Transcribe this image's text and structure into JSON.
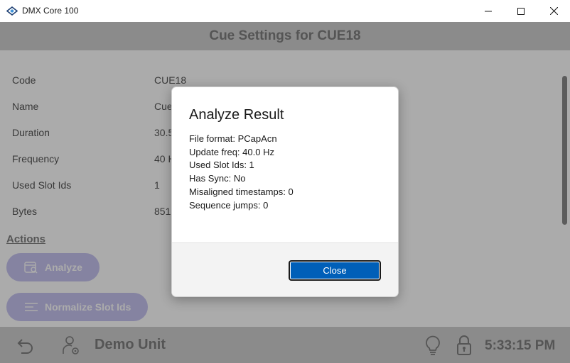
{
  "window": {
    "title": "DMX Core 100"
  },
  "header": {
    "title": "Cue Settings for CUE18"
  },
  "properties": [
    {
      "label": "Code",
      "value": "CUE18"
    },
    {
      "label": "Name",
      "value": "Cue"
    },
    {
      "label": "Duration",
      "value": "30.5"
    },
    {
      "label": "Frequency",
      "value": "40 H"
    },
    {
      "label": "Used Slot Ids",
      "value": "1"
    },
    {
      "label": "Bytes",
      "value": "851"
    }
  ],
  "actions": {
    "title": "Actions",
    "analyze_label": "Analyze",
    "normalize_label": "Normalize Slot Ids"
  },
  "footer": {
    "unit_name": "Demo Unit",
    "clock": "5:33:15 PM"
  },
  "dialog": {
    "title": "Analyze Result",
    "lines": [
      "File format: PCapAcn",
      "Update freq: 40.0 Hz",
      "Used Slot Ids: 1",
      "Has Sync: No",
      "Misaligned timestamps: 0",
      "Sequence jumps: 0"
    ],
    "close_label": "Close"
  },
  "colors": {
    "accent": "#005fb8",
    "action_button": "#c7c3f1",
    "bar_gray": "#cfcfcf"
  },
  "icons": {
    "app": "dmx-diamond-icon",
    "back": "back-arrow-icon",
    "user_settings": "user-settings-icon",
    "bulb": "lightbulb-icon",
    "lock": "lock-icon",
    "analyze": "analyze-icon",
    "normalize": "list-lines-icon"
  }
}
